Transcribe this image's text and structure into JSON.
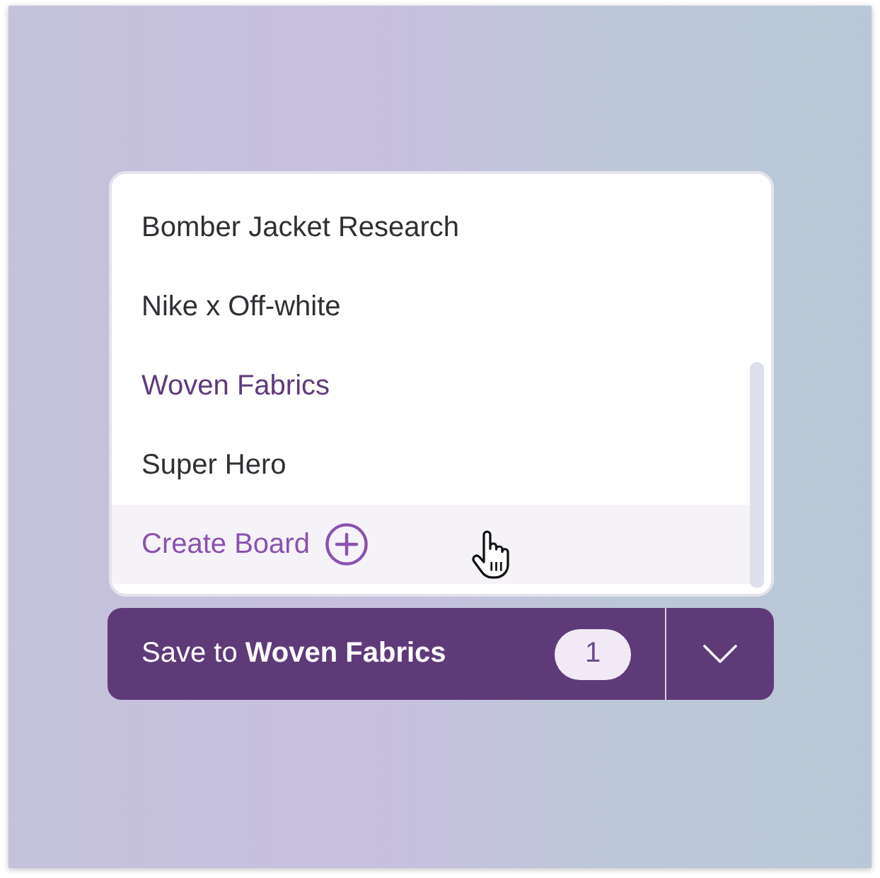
{
  "menu": {
    "items": [
      {
        "label": "Bomber Jacket Research",
        "selected": false
      },
      {
        "label": "Nike x Off-white",
        "selected": false
      },
      {
        "label": "Woven Fabrics",
        "selected": true
      },
      {
        "label": "Super Hero",
        "selected": false
      }
    ],
    "create_board": {
      "label": "Create Board",
      "hovered": true
    }
  },
  "save_button": {
    "label": "Save to **Woven Fabrics**",
    "count": "1"
  }
}
